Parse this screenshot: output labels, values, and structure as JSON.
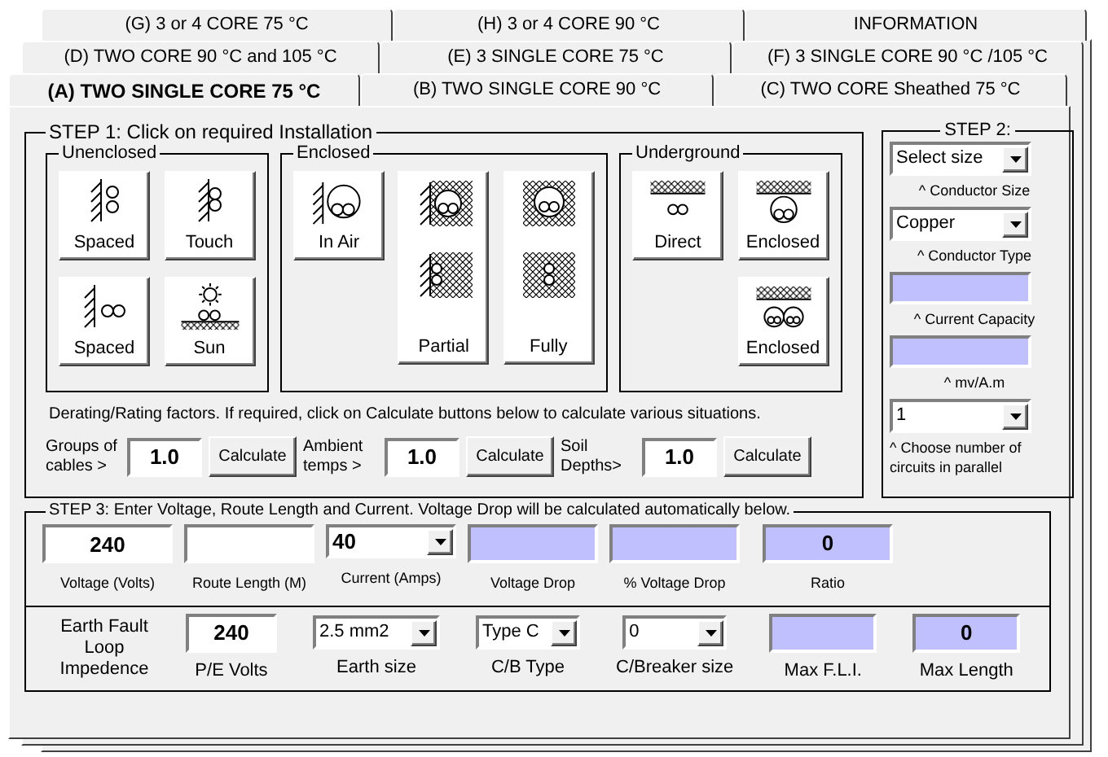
{
  "tab_rows": [
    [
      {
        "label": "(G)  3 or 4 CORE 75 °C",
        "selected": false
      },
      {
        "label": "(H)  3 or 4 CORE  90 °C",
        "selected": false
      },
      {
        "label": "INFORMATION",
        "selected": false
      }
    ],
    [
      {
        "label": "(D) TWO CORE  90 °C and 105 °C",
        "selected": false
      },
      {
        "label": "(E)  3 SINGLE CORE 75 °C",
        "selected": false
      },
      {
        "label": "(F) 3 SINGLE CORE 90 °C /105 °C",
        "selected": false
      }
    ],
    [
      {
        "label": "(A) TWO SINGLE  CORE 75 °C",
        "selected": true
      },
      {
        "label": "(B) TWO SINGLE CORE   90 °C",
        "selected": false
      },
      {
        "label": "(C) TWO CORE  Sheathed 75 °C",
        "selected": false
      }
    ]
  ],
  "step1": {
    "title": "STEP 1: Click on required Installation",
    "groups": [
      {
        "title": "Unenclosed",
        "buttons": [
          {
            "label": "Spaced"
          },
          {
            "label": "Touch"
          },
          {
            "label": "Spaced"
          },
          {
            "label": "Sun"
          }
        ]
      },
      {
        "title": "Enclosed",
        "buttons": [
          {
            "label": "In Air"
          },
          {
            "label": "Partial"
          },
          {
            "label": "Fully"
          }
        ]
      },
      {
        "title": "Underground",
        "buttons": [
          {
            "label": "Direct"
          },
          {
            "label": "Enclosed"
          },
          {
            "label": "Enclosed"
          }
        ]
      }
    ],
    "note": "Derating/Rating  factors.  If required, click on Calculate buttons below to calculate various situations.",
    "factors": [
      {
        "label": "Groups of cables >",
        "value": "1.0",
        "button": "Calculate"
      },
      {
        "label": "Ambient temps >",
        "value": "1.0",
        "button": "Calculate"
      },
      {
        "label": "Soil Depths>",
        "value": "1.0",
        "button": "Calculate"
      }
    ]
  },
  "step2": {
    "title": "STEP 2:",
    "items": [
      {
        "kind": "select",
        "value": "Select size"
      },
      {
        "kind": "caption",
        "text": "^ Conductor Size"
      },
      {
        "kind": "select",
        "value": "Copper"
      },
      {
        "kind": "caption",
        "text": "^ Conductor Type"
      },
      {
        "kind": "output"
      },
      {
        "kind": "caption",
        "text": "^ Current Capacity"
      },
      {
        "kind": "output"
      },
      {
        "kind": "caption",
        "text": "^ mv/A.m"
      },
      {
        "kind": "select",
        "value": "1"
      },
      {
        "kind": "note",
        "text": "^ Choose number of circuits in parallel"
      }
    ]
  },
  "step3": {
    "title": "STEP 3: Enter Voltage, Route Length and Current.   Voltage Drop will be calculated automatically below.",
    "fields": [
      {
        "kind": "input",
        "value": "240",
        "label": "Voltage  (Volts)"
      },
      {
        "kind": "input",
        "label": "Route Length (M)"
      },
      {
        "kind": "select",
        "value": "40",
        "label": "Current (Amps)"
      },
      {
        "kind": "output",
        "label": "Voltage Drop"
      },
      {
        "kind": "output",
        "label": "% Voltage Drop"
      },
      {
        "kind": "output",
        "value": "0",
        "label": "Ratio"
      }
    ]
  },
  "earth_fault": {
    "title": "Earth Fault Loop Impedence",
    "fields": [
      {
        "kind": "input",
        "value": "240",
        "label": "P/E Volts"
      },
      {
        "kind": "select",
        "value": "2.5 mm2",
        "label": "Earth size"
      },
      {
        "kind": "select",
        "value": "Type C",
        "label": "C/B Type"
      },
      {
        "kind": "select",
        "value": "0",
        "label": "C/Breaker size"
      },
      {
        "kind": "output",
        "label": "Max F.L.I."
      },
      {
        "kind": "output",
        "value": "0",
        "label": "Max  Length"
      }
    ]
  }
}
